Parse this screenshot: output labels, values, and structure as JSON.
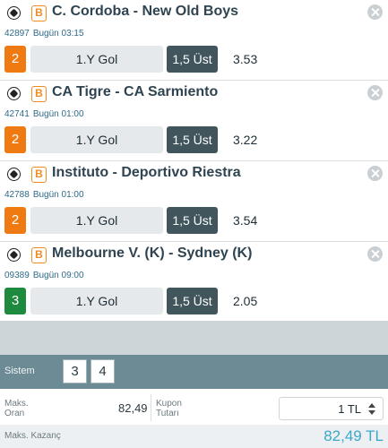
{
  "coupons": [
    {
      "title": "C. Cordoba - New Old Boys",
      "badge": "B",
      "code": "42897",
      "time": "Bugün 03:15",
      "mbs": "2",
      "mbs_color": "#f07a12",
      "market": "1.Y Gol",
      "pick": "1,5 Üst",
      "odd": "3.53"
    },
    {
      "title": "CA Tigre - CA Sarmiento",
      "badge": "B",
      "code": "42741",
      "time": "Bugün 01:00",
      "mbs": "2",
      "mbs_color": "#f07a12",
      "market": "1.Y Gol",
      "pick": "1,5 Üst",
      "odd": "3.22"
    },
    {
      "title": "Instituto - Deportivo Riestra",
      "badge": "B",
      "code": "42788",
      "time": "Bugün 01:00",
      "mbs": "2",
      "mbs_color": "#f07a12",
      "market": "1.Y Gol",
      "pick": "1,5 Üst",
      "odd": "3.54"
    },
    {
      "title": "Melbourne V. (K) - Sydney (K)",
      "badge": "B",
      "code": "09389",
      "time": "Bugün 09:00",
      "mbs": "3",
      "mbs_color": "#1d8a3d",
      "market": "1.Y Gol",
      "pick": "1,5 Üst",
      "odd": "2.05"
    }
  ],
  "system": {
    "label": "Sistem",
    "options": [
      "3",
      "4"
    ]
  },
  "summary": {
    "max_odds_label_1": "Maks.",
    "max_odds_label_2": "Oran",
    "max_odds_value": "82,49",
    "stake_label_1": "Kupon",
    "stake_label_2": "Tutarı",
    "stake_value": "1 TL",
    "max_win_label": "Maks. Kazanç",
    "max_win_value": "82,49 TL"
  },
  "colors": {
    "accent": "#f07a12",
    "green": "#1d8a3d",
    "pick_bg": "#40555c",
    "system_bar": "#6d8b95",
    "win": "#3aa8c8"
  }
}
